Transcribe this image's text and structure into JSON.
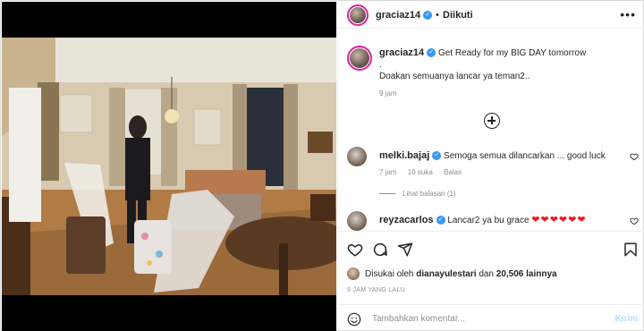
{
  "post": {
    "username": "graciaz14",
    "follow_status": "Diikuti",
    "more_label": "•••",
    "caption_line1": "Get Ready for my BIG DAY tomorrow",
    "caption_line2": ".",
    "caption_line3": "Doakan semuanya lancar ya teman2..",
    "caption_time": "9 jam"
  },
  "comments": [
    {
      "username": "melki.bajaj",
      "text": "Semoga semua dilancarkan ... good luck",
      "time": "7 jam",
      "likes": "10 suka",
      "reply_label": "Balas",
      "view_replies": "Lihat balasan (1)"
    },
    {
      "username": "reyzacarlos",
      "text": "Lancar2 ya bu grace",
      "hearts": "❤❤❤❤❤❤"
    }
  ],
  "likes_bar": {
    "prefix": "Disukai oleh",
    "user": "dianayulestari",
    "middle": "dan",
    "count": "20,506 lainnya"
  },
  "post_age": "9 JAM YANG LALU",
  "add_comment": {
    "placeholder": "Tambahkan komentar...",
    "send_label": "Kirim"
  },
  "colors": {
    "verified": "#3897f0",
    "send_disabled": "#b2dffc",
    "heart_red": "#ed1c24"
  },
  "icons": {
    "action_bar": [
      "heart-icon",
      "comment-icon",
      "share-icon",
      "bookmark-icon"
    ],
    "add_comment": "emoji-icon",
    "new_comment": "plus-circle-icon"
  }
}
